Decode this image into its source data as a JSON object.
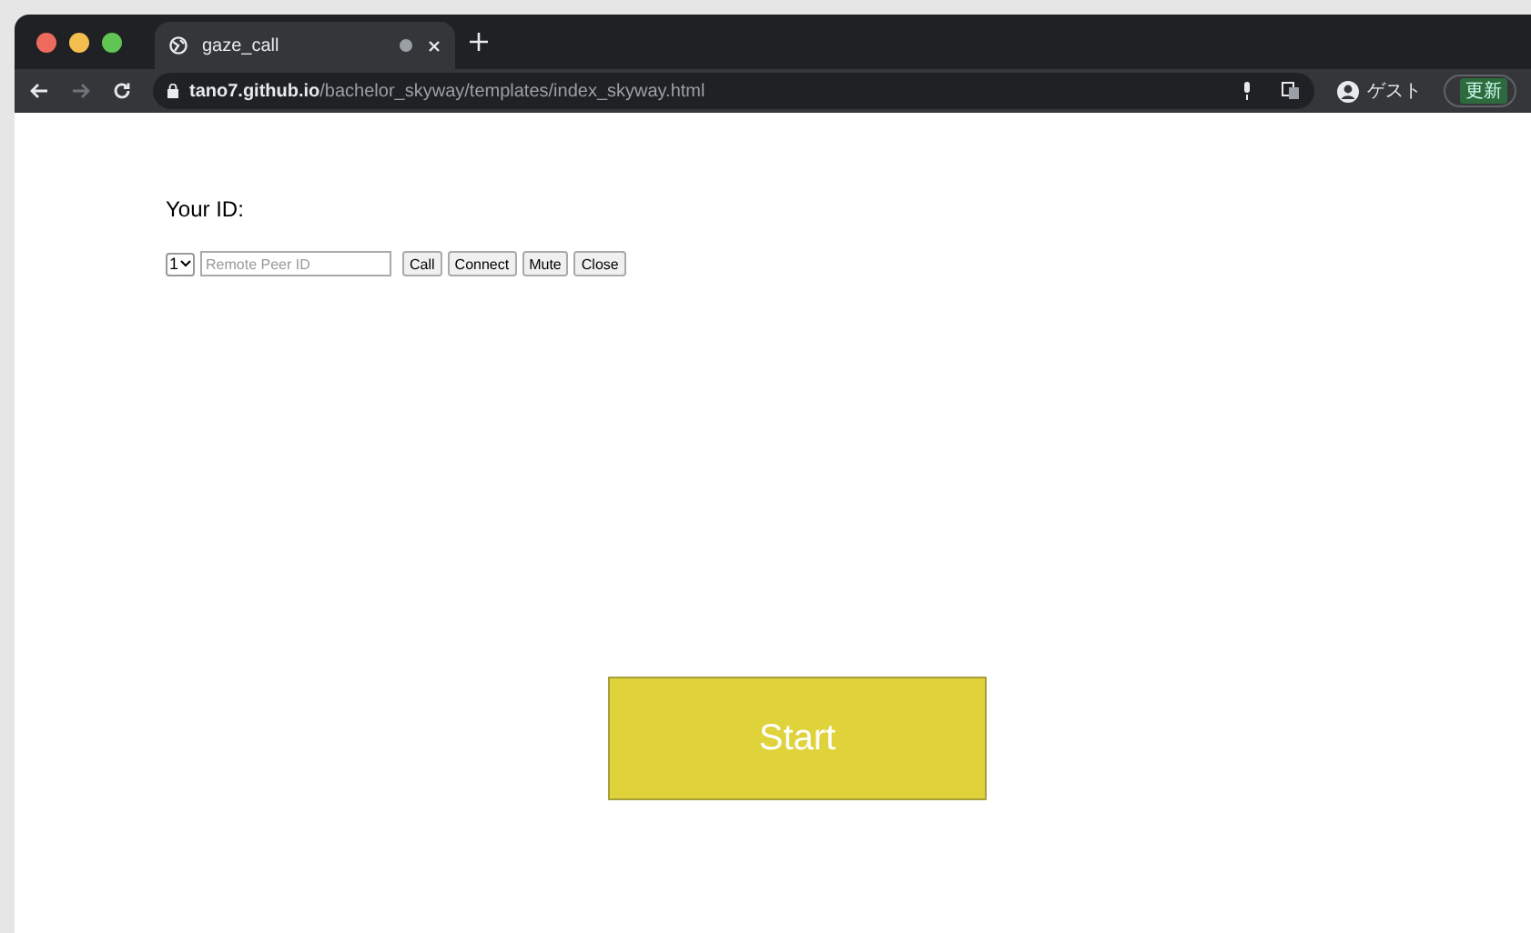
{
  "tabs": [
    {
      "title": "gaze_call",
      "selected": true
    }
  ],
  "toolbar": {
    "url_host": "tano7.github.io",
    "url_path": "/bachelor_skyway/templates/index_skyway.html",
    "profile": "ゲスト",
    "update_button": "更新"
  },
  "page": {
    "id_label": "Your ID:",
    "select_value": "1",
    "peer_field": {
      "placeholder": "Remote Peer ID"
    },
    "buttons": [
      "Call",
      "Connect",
      "Mute",
      "Close"
    ],
    "start_button": "Start"
  }
}
